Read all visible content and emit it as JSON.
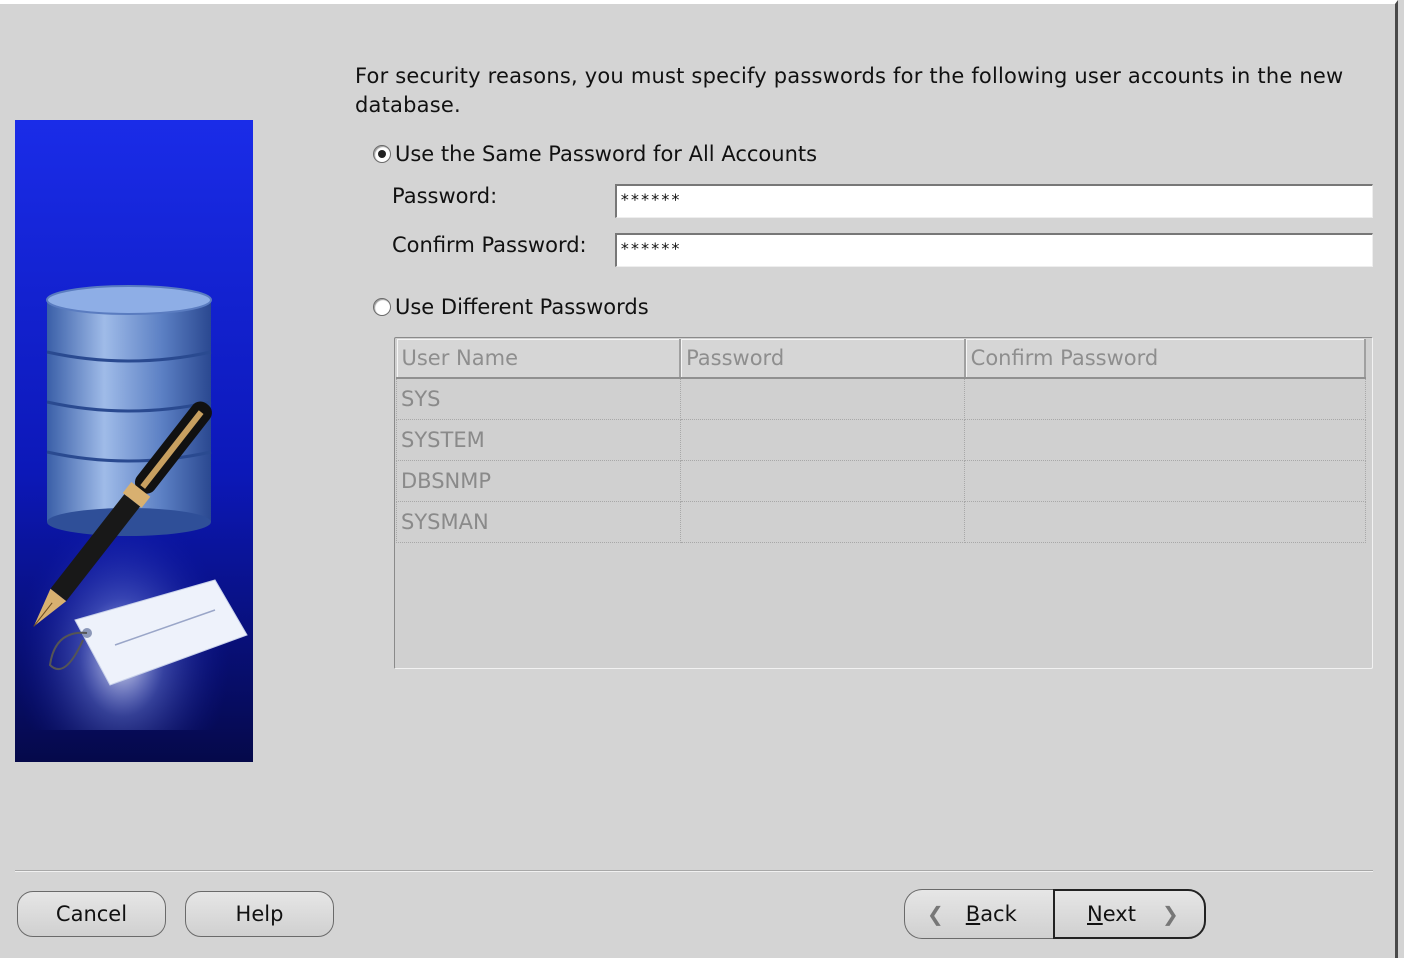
{
  "intro_text": "For security reasons, you must specify passwords for the following user accounts in the new database.",
  "same_password": {
    "label": "Use the Same Password for All Accounts",
    "selected": true,
    "password_label": "Password:",
    "password_value": "******",
    "confirm_label": "Confirm Password:",
    "confirm_value": "******"
  },
  "different_passwords": {
    "label": "Use Different Passwords",
    "selected": false
  },
  "accounts_table": {
    "columns": [
      "User Name",
      "Password",
      "Confirm Password"
    ],
    "rows": [
      {
        "user": "SYS",
        "password": "",
        "confirm": ""
      },
      {
        "user": "SYSTEM",
        "password": "",
        "confirm": ""
      },
      {
        "user": "DBSNMP",
        "password": "",
        "confirm": ""
      },
      {
        "user": "SYSMAN",
        "password": "",
        "confirm": ""
      }
    ]
  },
  "buttons": {
    "cancel": "Cancel",
    "help": "Help",
    "back_mnemonic": "B",
    "back_rest": "ack",
    "next_mnemonic": "N",
    "next_rest": "ext"
  },
  "icons": {
    "back": "chevron-left-icon",
    "next": "chevron-right-icon",
    "illustration": "database-pen-illustration"
  },
  "colors": {
    "background": "#d4d4d4",
    "sidebar_blue": "#1020d0"
  }
}
